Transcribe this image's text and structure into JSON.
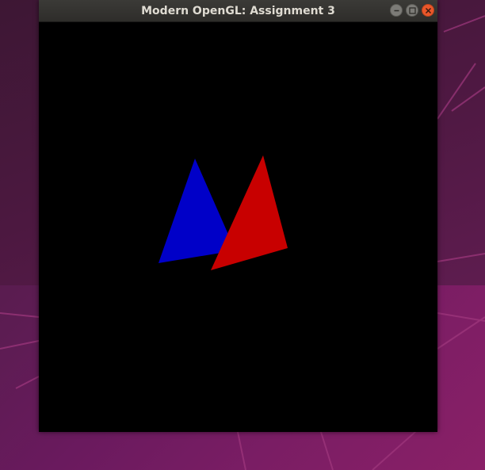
{
  "window": {
    "title": "Modern OpenGL: Assignment 3"
  },
  "titlebar_buttons": [
    "minimize-icon",
    "maximize-icon",
    "close-icon"
  ],
  "colors": {
    "blue_triangle": "#0000c8",
    "red_triangle": "#c80000",
    "canvas_background": "#000000",
    "close_button": "#e9572a"
  }
}
